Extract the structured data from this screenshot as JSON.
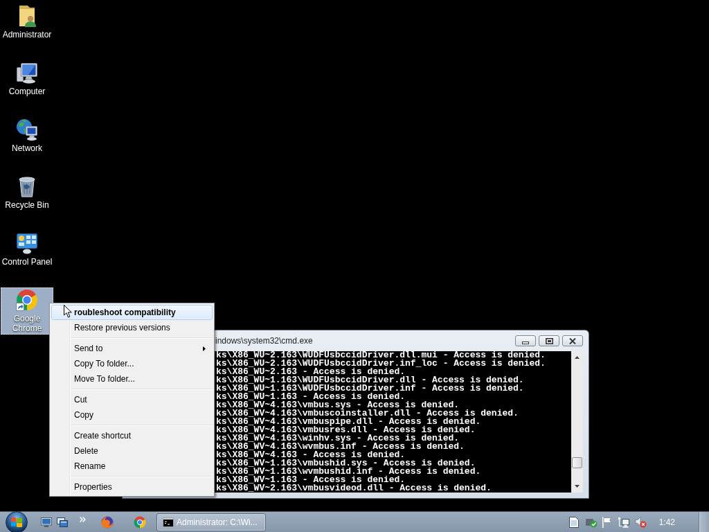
{
  "desktop_icons": [
    {
      "label": "Administrator",
      "selected": false
    },
    {
      "label": "Computer",
      "selected": false
    },
    {
      "label": "Network",
      "selected": false
    },
    {
      "label": "Recycle Bin",
      "selected": false
    },
    {
      "label": "Control Panel",
      "selected": false
    },
    {
      "label": "Google Chrome",
      "selected": true
    }
  ],
  "context_menu": {
    "sections": [
      {
        "items": [
          {
            "label": "roubleshoot compatibility",
            "default": true,
            "selected": true,
            "submenu": false
          },
          {
            "label": "Restore previous versions",
            "default": false,
            "selected": false,
            "submenu": false
          }
        ]
      },
      {
        "items": [
          {
            "label": "Send to",
            "default": false,
            "selected": false,
            "submenu": true
          },
          {
            "label": "Copy To folder...",
            "default": false,
            "selected": false,
            "submenu": false
          },
          {
            "label": "Move To folder...",
            "default": false,
            "selected": false,
            "submenu": false
          }
        ]
      },
      {
        "items": [
          {
            "label": "Cut",
            "default": false,
            "selected": false,
            "submenu": false
          },
          {
            "label": "Copy",
            "default": false,
            "selected": false,
            "submenu": false
          }
        ]
      },
      {
        "items": [
          {
            "label": "Create shortcut",
            "default": false,
            "selected": false,
            "submenu": false
          },
          {
            "label": "Delete",
            "default": false,
            "selected": false,
            "submenu": false
          },
          {
            "label": "Rename",
            "default": false,
            "selected": false,
            "submenu": false
          }
        ]
      },
      {
        "items": [
          {
            "label": "Properties",
            "default": false,
            "selected": false,
            "submenu": false
          }
        ]
      }
    ]
  },
  "console_window": {
    "title": "indows\\system32\\cmd.exe",
    "lines": [
      "ks\\X86_WU~2.163\\WUDFUsbccidDriver.dll.mui - Access is denied.",
      "ks\\X86_WU~2.163\\WUDFUsbccidDriver.inf_loc - Access is denied.",
      "ks\\X86_WU~2.163 - Access is denied.",
      "ks\\X86_WU~1.163\\WUDFUsbccidDriver.dll - Access is denied.",
      "ks\\X86_WU~1.163\\WUDFUsbccidDriver.inf - Access is denied.",
      "ks\\X86_WU~1.163 - Access is denied.",
      "ks\\X86_WV~4.163\\vmbus.sys - Access is denied.",
      "ks\\X86_WV~4.163\\vmbuscoinstaller.dll - Access is denied.",
      "ks\\X86_WV~4.163\\vmbuspipe.dll - Access is denied.",
      "ks\\X86_WV~4.163\\vmbusres.dll - Access is denied.",
      "ks\\X86_WV~4.163\\winhv.sys - Access is denied.",
      "ks\\X86_WV~4.163\\wvmbus.inf - Access is denied.",
      "ks\\X86_WV~4.163 - Access is denied.",
      "ks\\X86_WV~1.163\\vmbushid.sys - Access is denied.",
      "ks\\X86_WV~1.163\\wvmbushid.inf - Access is denied.",
      "ks\\X86_WV~1.163 - Access is denied.",
      "ks\\X86_WV~2.163\\vmbusvideod.dll - Access is denied."
    ]
  },
  "taskbar": {
    "task_button": {
      "label": "Administrator: C:\\Wi..."
    },
    "clock": "1:42"
  }
}
